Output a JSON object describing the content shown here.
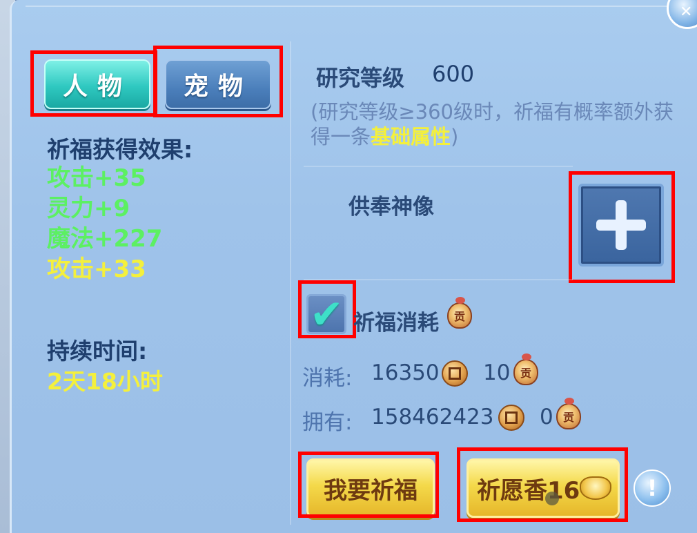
{
  "tabs": [
    {
      "label": "人物",
      "active": true
    },
    {
      "label": "宠物",
      "active": false
    }
  ],
  "effects": {
    "title": "祈福获得效果:",
    "items": [
      {
        "text": "攻击+35",
        "color": "#5cf062"
      },
      {
        "text": "灵力+9",
        "color": "#5cf062"
      },
      {
        "text": "魔法+227",
        "color": "#5cf062"
      },
      {
        "text": "攻击+33",
        "color": "#f4f03c"
      }
    ]
  },
  "duration": {
    "title": "持续时间:",
    "value": "2天18小时"
  },
  "research": {
    "label": "研究等级",
    "value": "600",
    "note_prefix": "(研究等级≥360级时，祈福有概率额外获得一条",
    "note_highlight": "基础属性",
    "note_suffix": ")"
  },
  "statue": {
    "label": "供奉神像"
  },
  "blessing_cost": {
    "label": "祈福消耗",
    "checked": true,
    "medal_icon_text": "贡"
  },
  "consume": {
    "label": "消耗:",
    "coins": "16350",
    "medals": "10"
  },
  "own": {
    "label": "拥有:",
    "coins": "158462423",
    "medals": "0"
  },
  "buttons": {
    "pray": "我要祈福",
    "incense": "祈愿香16"
  },
  "colors": {
    "effect_green": "#5cf062",
    "highlight_yellow": "#f4f03c",
    "annotation_red": "#ff0000"
  }
}
